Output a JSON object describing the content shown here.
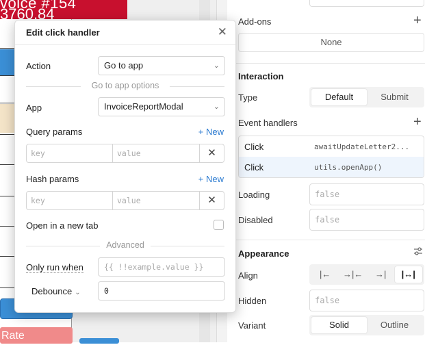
{
  "canvas": {
    "banner_line1": "voice #154",
    "banner_line2": "3760.84",
    "rate_label": "Rate"
  },
  "inspector": {
    "addons_label": "Add-ons",
    "addons_value": "None",
    "interaction_title": "Interaction",
    "type_label": "Type",
    "type_options": [
      "Default",
      "Submit"
    ],
    "type_selected": "Default",
    "event_handlers_label": "Event handlers",
    "handlers": [
      {
        "event": "Click",
        "action": "awaitUpdateLetter2..."
      },
      {
        "event": "Click",
        "action": "utils.openApp()"
      }
    ],
    "loading_label": "Loading",
    "loading_placeholder": "false",
    "disabled_label": "Disabled",
    "disabled_placeholder": "false",
    "appearance_title": "Appearance",
    "align_label": "Align",
    "align_options": [
      "|←",
      "→|←",
      "→|",
      "|↔|"
    ],
    "align_selected": "|↔|",
    "hidden_label": "Hidden",
    "hidden_placeholder": "false",
    "variant_label": "Variant",
    "variant_options": [
      "Solid",
      "Outline"
    ],
    "variant_selected": "Solid"
  },
  "modal": {
    "title": "Edit click handler",
    "action_label": "Action",
    "action_value": "Go to app",
    "options_separator": "Go to app options",
    "app_label": "App",
    "app_value": "InvoiceReportModal",
    "query_params_label": "Query params",
    "new_label": "+ New",
    "key_placeholder": "key",
    "value_placeholder": "value",
    "hash_params_label": "Hash params",
    "open_new_tab_label": "Open in a new tab",
    "advanced_separator": "Advanced",
    "only_run_when_label": "Only run when",
    "only_run_when_placeholder": "{{ !!example.value }}",
    "debounce_label": "Debounce",
    "debounce_value": "0"
  },
  "colors": {
    "banner": "#c8102e",
    "accent": "#2a7ad0",
    "canvas_blue": "#3b8fd6",
    "rate": "#f08a8a"
  },
  "icons": [
    "close-icon",
    "plus-icon",
    "chevron-down-icon",
    "settings-sliders-icon",
    "remove-icon"
  ]
}
